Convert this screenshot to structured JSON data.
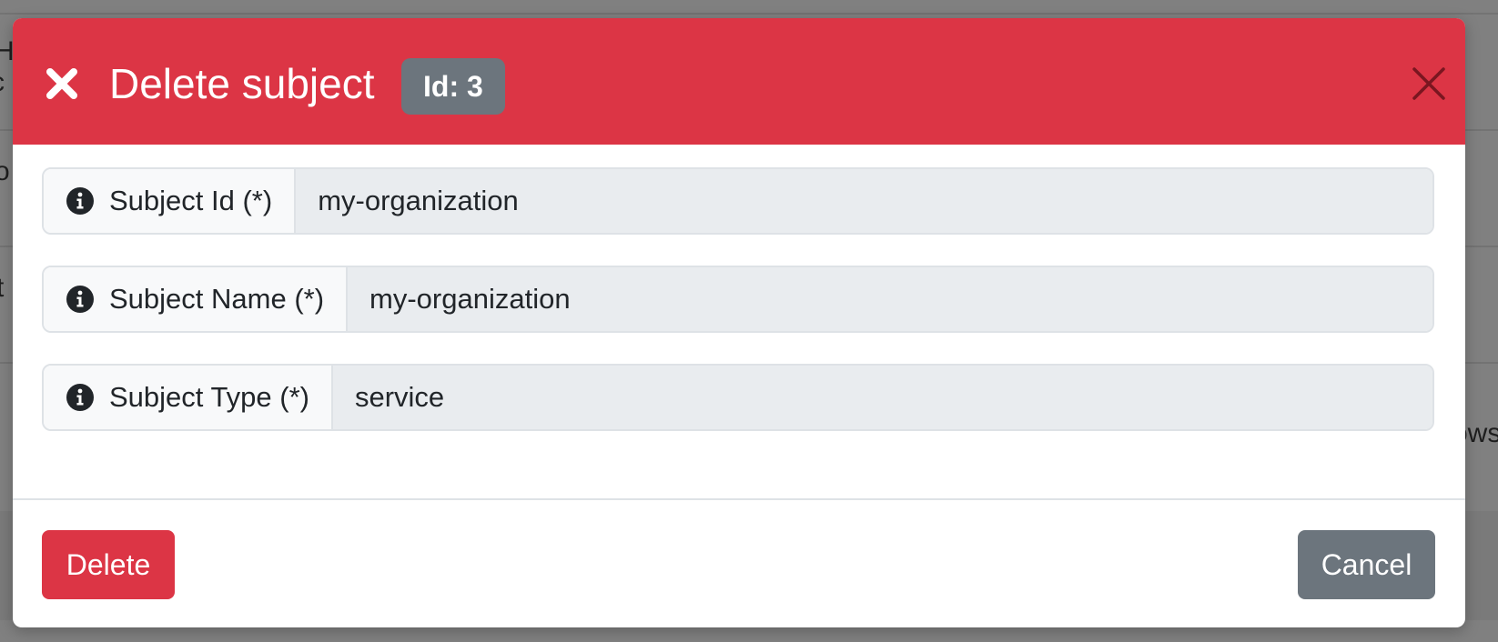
{
  "modal": {
    "title": "Delete subject",
    "id_badge": "Id: 3",
    "header_icon": "x-icon",
    "close_icon": "close-icon",
    "accent_color": "#dc3545"
  },
  "fields": [
    {
      "label": "Subject Id (*)",
      "value": "my-organization",
      "icon": "info-icon"
    },
    {
      "label": "Subject Name (*)",
      "value": "my-organization",
      "icon": "info-icon"
    },
    {
      "label": "Subject Type (*)",
      "value": "service",
      "icon": "info-icon"
    }
  ],
  "footer": {
    "delete_label": "Delete",
    "cancel_label": "Cancel"
  },
  "background": {
    "fragment_1": "HA",
    "fragment_2": "c",
    "fragment_3": "o",
    "fragment_4": "t",
    "fragment_5": "ows"
  }
}
